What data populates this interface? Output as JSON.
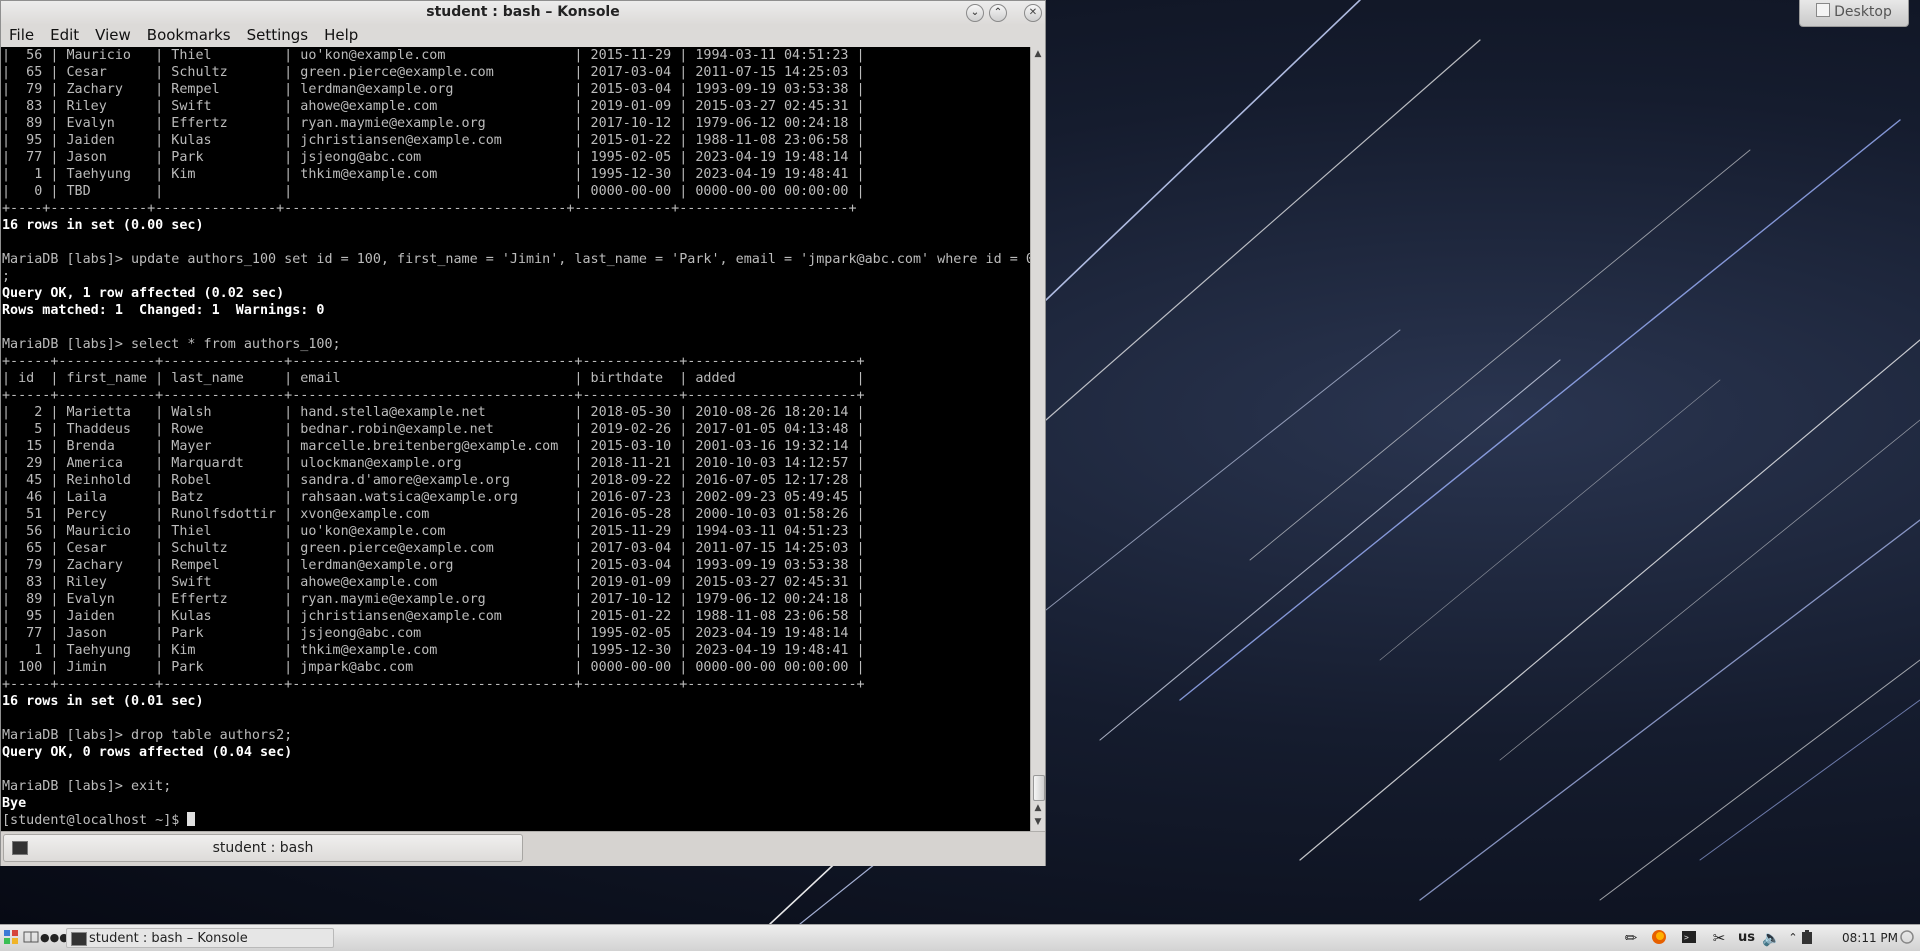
{
  "desktop": {
    "button_label": "Desktop"
  },
  "window": {
    "title": "student : bash – Konsole",
    "menu": [
      "File",
      "Edit",
      "View",
      "Bookmarks",
      "Settings",
      "Help"
    ],
    "tab_label": "student : bash"
  },
  "terminal": {
    "lines": [
      {
        "t": "|  56 | Mauricio   | Thiel         | uo'kon@example.com                | 2015-11-29 | 1994-03-11 04:51:23 |",
        "b": false
      },
      {
        "t": "|  65 | Cesar      | Schultz       | green.pierce@example.com          | 2017-03-04 | 2011-07-15 14:25:03 |",
        "b": false
      },
      {
        "t": "|  79 | Zachary    | Rempel        | lerdman@example.org               | 2015-03-04 | 1993-09-19 03:53:38 |",
        "b": false
      },
      {
        "t": "|  83 | Riley      | Swift         | ahowe@example.com                 | 2019-01-09 | 2015-03-27 02:45:31 |",
        "b": false
      },
      {
        "t": "|  89 | Evalyn     | Effertz       | ryan.maymie@example.org           | 2017-10-12 | 1979-06-12 00:24:18 |",
        "b": false
      },
      {
        "t": "|  95 | Jaiden     | Kulas         | jchristiansen@example.com         | 2015-01-22 | 1988-11-08 23:06:58 |",
        "b": false
      },
      {
        "t": "|  77 | Jason      | Park          | jsjeong@abc.com                   | 1995-02-05 | 2023-04-19 19:48:14 |",
        "b": false
      },
      {
        "t": "|   1 | Taehyung   | Kim           | thkim@example.com                 | 1995-12-30 | 2023-04-19 19:48:41 |",
        "b": false
      },
      {
        "t": "|   0 | TBD        |               |                                   | 0000-00-00 | 0000-00-00 00:00:00 |",
        "b": false
      },
      {
        "t": "+----+------------+---------------+-----------------------------------+------------+---------------------+",
        "b": false
      },
      {
        "t": "16 rows in set (0.00 sec)",
        "b": true
      },
      {
        "t": "",
        "b": false
      },
      {
        "t": "MariaDB [labs]> update authors_100 set id = 100, first_name = 'Jimin', last_name = 'Park', email = 'jmpark@abc.com' where id = 0",
        "b": false
      },
      {
        "t": ";",
        "b": false
      },
      {
        "t": "Query OK, 1 row affected (0.02 sec)",
        "b": true
      },
      {
        "t": "Rows matched: 1  Changed: 1  Warnings: 0",
        "b": true
      },
      {
        "t": "",
        "b": false
      },
      {
        "t": "MariaDB [labs]> select * from authors_100;",
        "b": false
      },
      {
        "t": "+-----+------------+---------------+-----------------------------------+------------+---------------------+",
        "b": false
      },
      {
        "t": "| id  | first_name | last_name     | email                             | birthdate  | added               |",
        "b": false
      },
      {
        "t": "+-----+------------+---------------+-----------------------------------+------------+---------------------+",
        "b": false
      },
      {
        "t": "|   2 | Marietta   | Walsh         | hand.stella@example.net           | 2018-05-30 | 2010-08-26 18:20:14 |",
        "b": false
      },
      {
        "t": "|   5 | Thaddeus   | Rowe          | bednar.robin@example.net          | 2019-02-26 | 2017-01-05 04:13:48 |",
        "b": false
      },
      {
        "t": "|  15 | Brenda     | Mayer         | marcelle.breitenberg@example.com  | 2015-03-10 | 2001-03-16 19:32:14 |",
        "b": false
      },
      {
        "t": "|  29 | America    | Marquardt     | ulockman@example.org              | 2018-11-21 | 2010-10-03 14:12:57 |",
        "b": false
      },
      {
        "t": "|  45 | Reinhold   | Robel         | sandra.d'amore@example.org        | 2018-09-22 | 2016-07-05 12:17:28 |",
        "b": false
      },
      {
        "t": "|  46 | Laila      | Batz          | rahsaan.watsica@example.org       | 2016-07-23 | 2002-09-23 05:49:45 |",
        "b": false
      },
      {
        "t": "|  51 | Percy      | Runolfsdottir | xvon@example.com                  | 2016-05-28 | 2000-10-03 01:58:26 |",
        "b": false
      },
      {
        "t": "|  56 | Mauricio   | Thiel         | uo'kon@example.com                | 2015-11-29 | 1994-03-11 04:51:23 |",
        "b": false
      },
      {
        "t": "|  65 | Cesar      | Schultz       | green.pierce@example.com          | 2017-03-04 | 2011-07-15 14:25:03 |",
        "b": false
      },
      {
        "t": "|  79 | Zachary    | Rempel        | lerdman@example.org               | 2015-03-04 | 1993-09-19 03:53:38 |",
        "b": false
      },
      {
        "t": "|  83 | Riley      | Swift         | ahowe@example.com                 | 2019-01-09 | 2015-03-27 02:45:31 |",
        "b": false
      },
      {
        "t": "|  89 | Evalyn     | Effertz       | ryan.maymie@example.org           | 2017-10-12 | 1979-06-12 00:24:18 |",
        "b": false
      },
      {
        "t": "|  95 | Jaiden     | Kulas         | jchristiansen@example.com         | 2015-01-22 | 1988-11-08 23:06:58 |",
        "b": false
      },
      {
        "t": "|  77 | Jason      | Park          | jsjeong@abc.com                   | 1995-02-05 | 2023-04-19 19:48:14 |",
        "b": false
      },
      {
        "t": "|   1 | Taehyung   | Kim           | thkim@example.com                 | 1995-12-30 | 2023-04-19 19:48:41 |",
        "b": false
      },
      {
        "t": "| 100 | Jimin      | Park          | jmpark@abc.com                    | 0000-00-00 | 0000-00-00 00:00:00 |",
        "b": false
      },
      {
        "t": "+-----+------------+---------------+-----------------------------------+------------+---------------------+",
        "b": false
      },
      {
        "t": "16 rows in set (0.01 sec)",
        "b": true
      },
      {
        "t": "",
        "b": false
      },
      {
        "t": "MariaDB [labs]> drop table authors2;",
        "b": false
      },
      {
        "t": "Query OK, 0 rows affected (0.04 sec)",
        "b": true
      },
      {
        "t": "",
        "b": false
      },
      {
        "t": "MariaDB [labs]> exit;",
        "b": false
      },
      {
        "t": "Bye",
        "b": true
      }
    ],
    "prompt": "[student@localhost ~]$ "
  },
  "taskbar": {
    "task_label": "student : bash – Konsole",
    "keyboard_layout": "us",
    "clock": "08:11 PM"
  },
  "icons": {
    "launcher": "kde-launcher-icon",
    "volume": "volume-icon",
    "firefox": "firefox-icon",
    "terminal": "terminal-icon"
  }
}
